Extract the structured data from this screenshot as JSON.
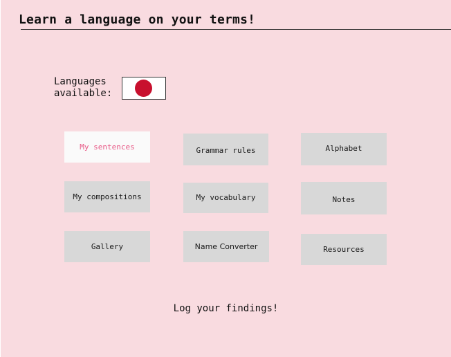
{
  "header": {
    "title": "Learn a language on your terms!"
  },
  "languages": {
    "label": "Languages\navailable:",
    "flag_icon": "japan-flag-icon",
    "flag_colors": {
      "background": "#ffffff",
      "sun": "#c8102e"
    }
  },
  "menu": {
    "my_sentences": "My sentences",
    "grammar_rules": "Grammar rules",
    "alphabet": "Alphabet",
    "my_compositions": "My compositions",
    "my_vocabulary": "My vocabulary",
    "notes": "Notes",
    "gallery": "Gallery",
    "name_converter": "Name Converter",
    "resources": "Resources",
    "active_item": "My sentences"
  },
  "footer": {
    "text": "Log your findings!"
  },
  "colors": {
    "page_background": "#f9dbe0",
    "tile_background": "#d8d8d8",
    "active_tile_background": "#fafafa",
    "active_text": "#e85a87"
  }
}
